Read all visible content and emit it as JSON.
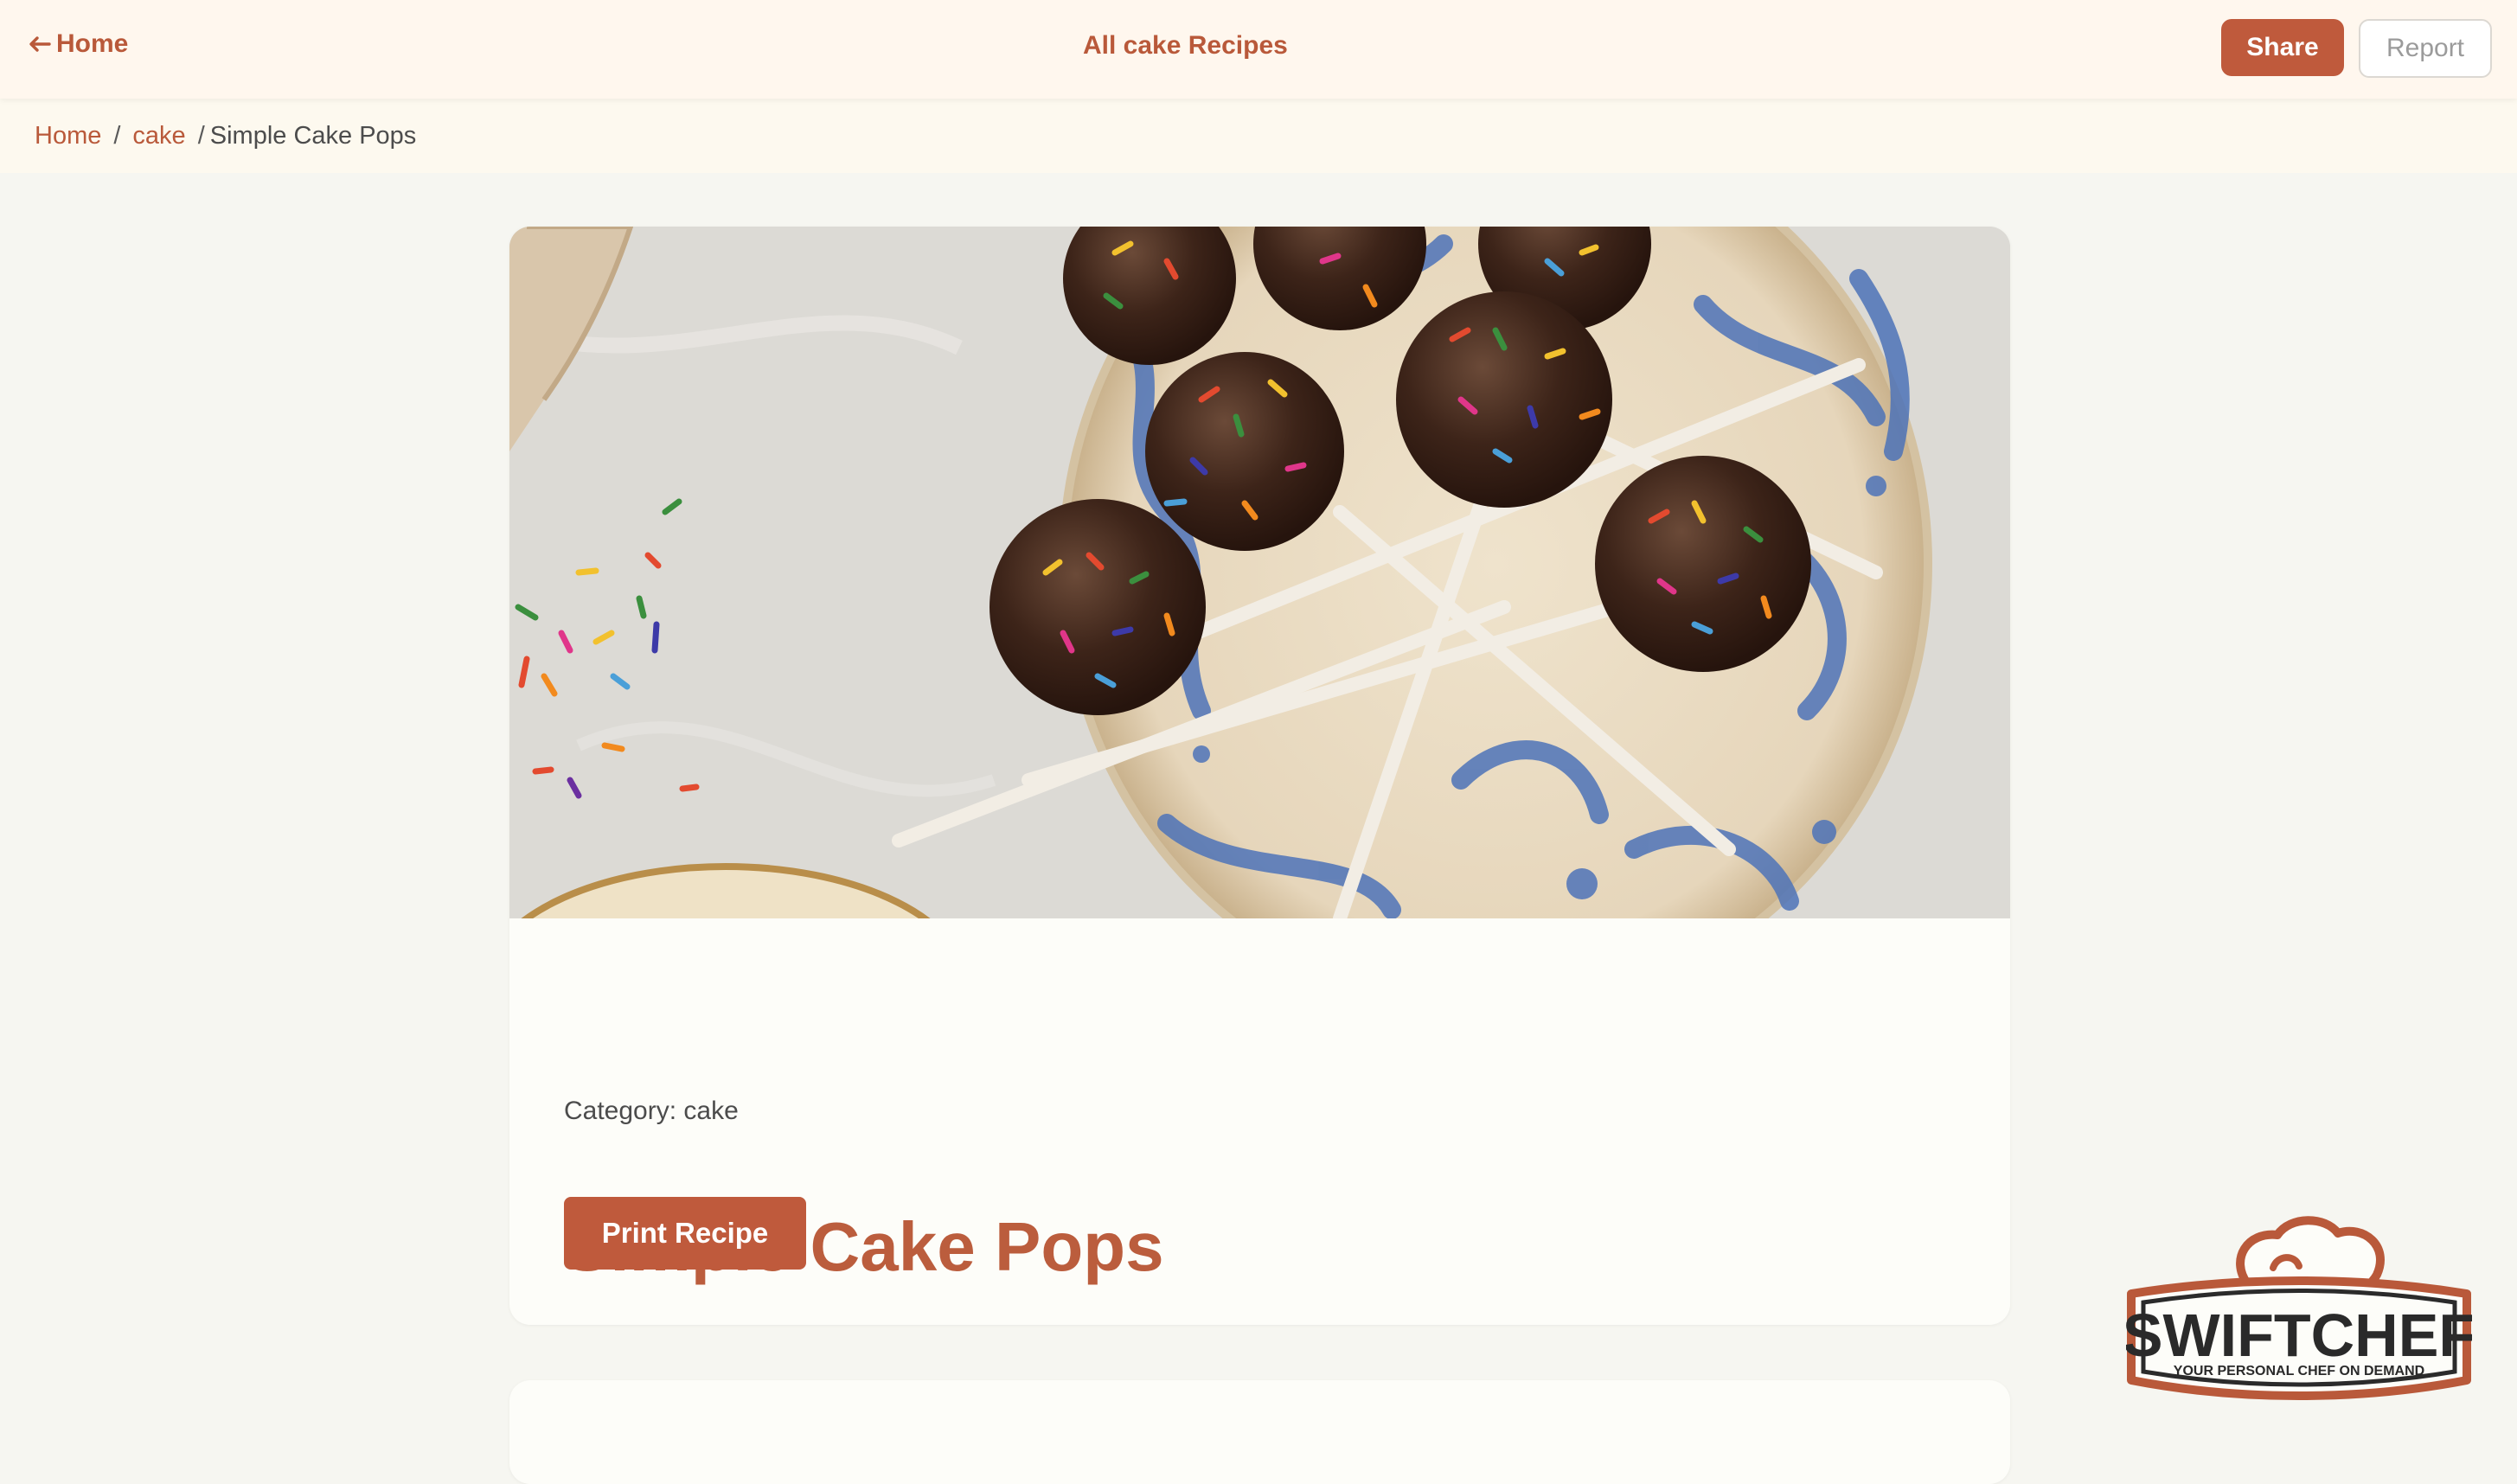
{
  "topbar": {
    "home_label": "Home",
    "title": "All cake Recipes",
    "share_label": "Share",
    "report_label": "Report"
  },
  "breadcrumb": {
    "items": [
      "Home",
      "cake",
      "Simple Cake Pops"
    ],
    "separator": "/"
  },
  "recipe": {
    "title": "Simple Cake Pops",
    "category_text": "Category: cake",
    "print_label": "Print Recipe",
    "image_alt": "Chocolate cake pops with rainbow sprinkles on a blue-patterned plate"
  },
  "logo": {
    "brand": "SWIFTCHEF",
    "tagline": "YOUR PERSONAL CHEF ON DEMAND"
  },
  "colors": {
    "accent": "#bf5a3c",
    "topbar_bg": "#fff7ee",
    "page_bg": "#f6f6f1",
    "breadcrumb_bg": "#fdf9ef",
    "card_bg": "#fdfdf9"
  }
}
